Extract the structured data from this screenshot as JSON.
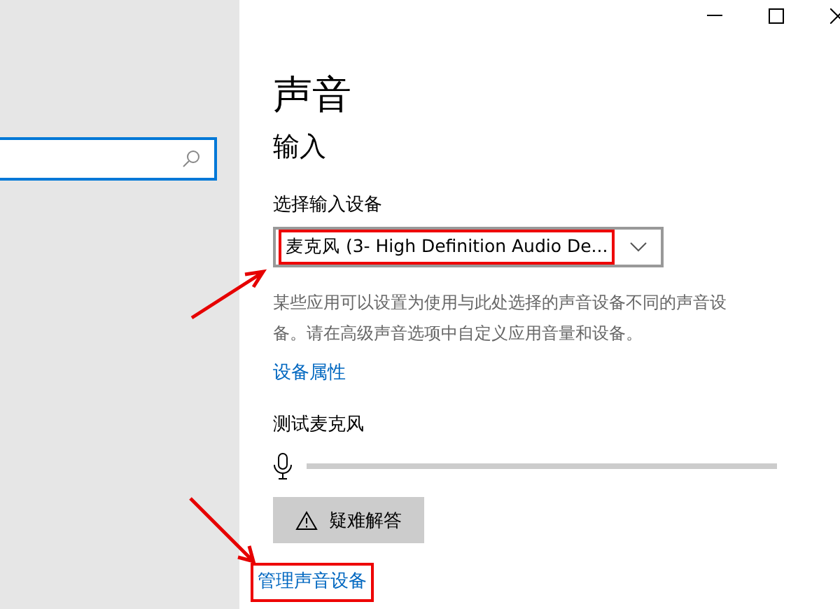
{
  "page": {
    "title": "声音",
    "section": "输入",
    "device_label": "选择输入设备",
    "device_value": "麦克风 (3- High Definition Audio De...",
    "description": "某些应用可以设置为使用与此处选择的声音设备不同的声音设备。请在高级声音选项中自定义应用音量和设备。",
    "properties_link": "设备属性",
    "test_label": "测试麦克风",
    "meter": {
      "level": 0
    },
    "troubleshoot_button": "疑难解答",
    "manage_link": "管理声音设备"
  }
}
